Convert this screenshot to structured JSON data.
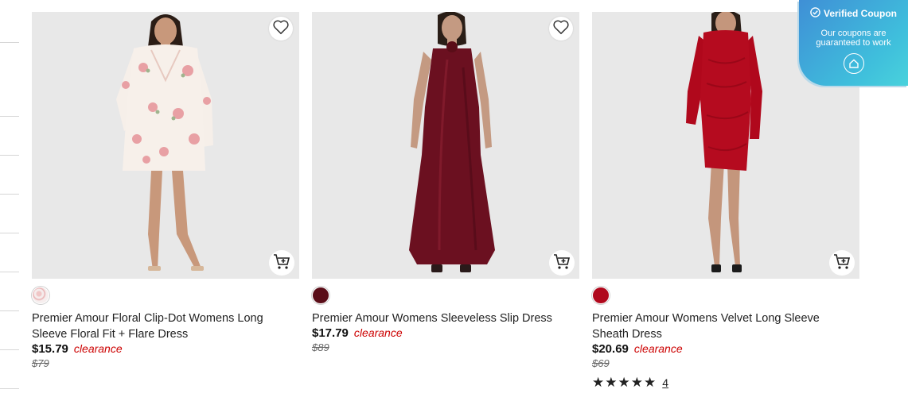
{
  "products": [
    {
      "name": "Premier Amour Floral Clip-Dot Womens Long Sleeve Floral Fit + Flare Dress",
      "price": "$15.79",
      "badge": "clearance",
      "original_price": "$79",
      "swatch_color": "#f1dada"
    },
    {
      "name": "Premier Amour Womens Sleeveless Slip Dress",
      "price": "$17.79",
      "badge": "clearance",
      "original_price": "$89",
      "swatch_color": "#5a0d18"
    },
    {
      "name": "Premier Amour Womens Velvet Long Sleeve Sheath Dress",
      "price": "$20.69",
      "badge": "clearance",
      "original_price": "$69",
      "swatch_color": "#b0081c",
      "rating": 5,
      "review_count": "4"
    }
  ],
  "coupon": {
    "title": "Verified Coupon",
    "line1": "Our coupons are",
    "line2": "guaranteed to work"
  },
  "icons": {
    "favorite": "heart-outline-icon",
    "cart": "add-to-cart-icon",
    "verified": "check-circle-icon",
    "badge": "shield-home-icon"
  },
  "colors": {
    "clearance": "#cc0000",
    "coupon_start": "#3f8fd6",
    "coupon_end": "#49d2dc"
  }
}
